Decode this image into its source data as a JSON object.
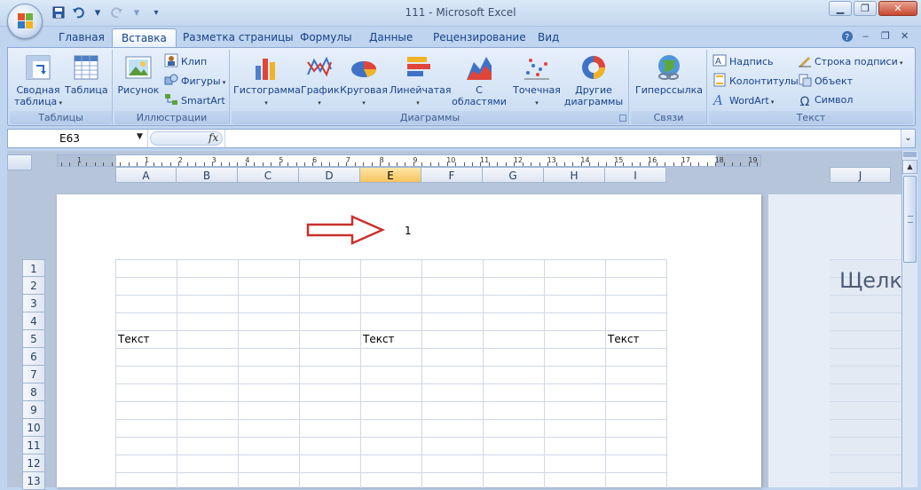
{
  "window": {
    "title": "111 - Microsoft Excel",
    "minimize": "▁",
    "maximize": "❐",
    "close": "✕"
  },
  "tabs": [
    "Главная",
    "Вставка",
    "Разметка страницы",
    "Формулы",
    "Данные",
    "Рецензирование",
    "Вид"
  ],
  "active_tab": "Вставка",
  "ribbon": {
    "groups": {
      "tables": {
        "label": "Таблицы",
        "pivot": "Сводная таблица",
        "pivot_line1": "Сводная",
        "pivot_line2": "таблица",
        "table": "Таблица"
      },
      "illustrations": {
        "label": "Иллюстрации",
        "picture": "Рисунок",
        "clip": "Клип",
        "shapes": "Фигуры",
        "smartart": "SmartArt"
      },
      "charts": {
        "label": "Диаграммы",
        "histogram": "Гистограмма",
        "graph": "График",
        "pie": "Круговая",
        "bar": "Линейчатая",
        "area_line1": "С",
        "area_line2": "областями",
        "scatter": "Точечная",
        "other_line1": "Другие",
        "other_line2": "диаграммы"
      },
      "links": {
        "label": "Связи",
        "hyperlink": "Гиперссылка"
      },
      "text": {
        "label": "Текст",
        "textbox": "Надпись",
        "headers": "Колонтитулы",
        "wordart": "WordArt",
        "signature": "Строка подписи",
        "object": "Объект",
        "symbol": "Символ"
      }
    }
  },
  "formula_bar": {
    "name_box": "E63",
    "fx": "fx",
    "formula": ""
  },
  "ruler": {
    "numbers": [
      "1",
      "1",
      "2",
      "3",
      "4",
      "5",
      "6",
      "7",
      "8",
      "9",
      "10",
      "11",
      "12",
      "13",
      "14",
      "15",
      "16",
      "17",
      "18",
      "19"
    ]
  },
  "columns": [
    "A",
    "B",
    "C",
    "D",
    "E",
    "F",
    "G",
    "H",
    "I"
  ],
  "selected_column": "E",
  "extra_column": "J",
  "rows": [
    "1",
    "2",
    "3",
    "4",
    "5",
    "6",
    "7",
    "8",
    "9",
    "10",
    "11",
    "12",
    "13"
  ],
  "page_header": "1",
  "cells": {
    "A5": "Текст",
    "E5": "Текст",
    "I5": "Текст"
  },
  "next_page_hint": "Щелкн"
}
